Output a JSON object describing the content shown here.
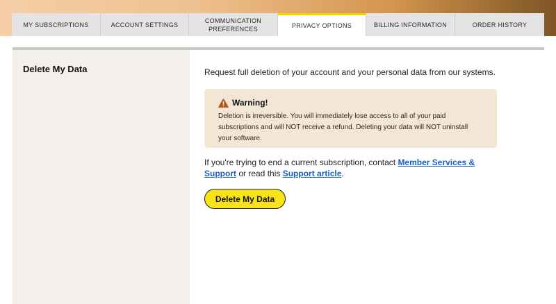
{
  "tabs": [
    {
      "label": "MY SUBSCRIPTIONS",
      "active": false
    },
    {
      "label": "ACCOUNT SETTINGS",
      "active": false
    },
    {
      "label_line1": "COMMUNICATION",
      "label_line2": "PREFERENCES",
      "active": false
    },
    {
      "label": "PRIVACY OPTIONS",
      "active": true
    },
    {
      "label": "BILLING INFORMATION",
      "active": false
    },
    {
      "label": "ORDER HISTORY",
      "active": false
    }
  ],
  "sidebar": {
    "title": "Delete My Data"
  },
  "main": {
    "intro": "Request full deletion of your account and your personal data from our systems.",
    "warning": {
      "icon": "warning-triangle-icon",
      "title": "Warning!",
      "body": "Deletion is irreversible. You will immediately lose access to all of your paid subscriptions and will NOT receive a refund. Deleting your data will NOT uninstall your software."
    },
    "contact": {
      "text_before": "If you're trying to end a current subscription, contact ",
      "link1": "Member Services & Support",
      "text_middle": " or read this ",
      "link2": "Support article",
      "text_after": "."
    },
    "delete_button": "Delete My Data"
  },
  "colors": {
    "accent_yellow": "#f8e21a",
    "active_tab_border": "#f3d400",
    "link": "#1a5fc4",
    "warning_bg": "#f3e6d4",
    "warning_icon": "#b4581a",
    "sidebar_bg": "#f3f0eb"
  }
}
